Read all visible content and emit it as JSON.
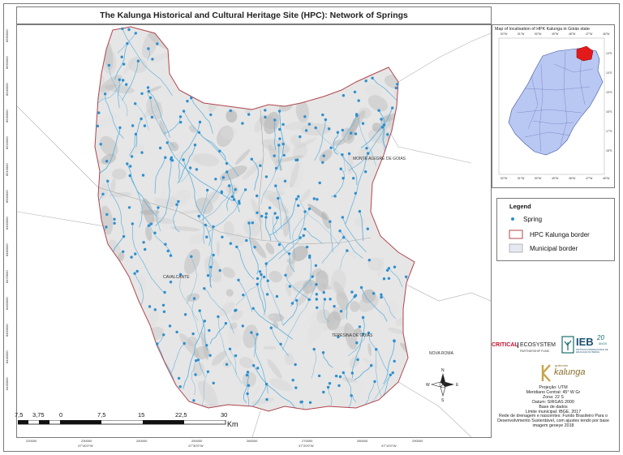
{
  "title": "The Kalunga Historical and Cultural Heritage Site (HPC): Network of Springs",
  "map": {
    "place_labels": [
      {
        "text": "MONTE ALEGRE DE GOIAS"
      },
      {
        "text": "CAVALCANTE"
      },
      {
        "text": "TERESINA DE GOIAS"
      },
      {
        "text": "NOVA ROMA"
      }
    ],
    "left_coords": [
      "8560000",
      "8550000",
      "8540000",
      "8530000",
      "8520000",
      "8510000",
      "8500000",
      "8490000",
      "8480000",
      "8470000",
      "8460000",
      "8450000",
      "8440000",
      "8430000"
    ],
    "bottom_coords": [
      "220000",
      "230000",
      "240000",
      "250000",
      "260000",
      "270000",
      "280000",
      "290000"
    ],
    "bottom_coords_deg": [
      "47°40'0\"W",
      "47°30'0\"W",
      "47°20'0\"W",
      "47°10'0\"W"
    ],
    "colors": {
      "border": "#b0444d",
      "spring": "#2d8fcf",
      "river": "#5fb0dc",
      "relief": "#d4d4d4"
    }
  },
  "inset": {
    "title": "Map of localisation of HPK Kalunga in Goiás state",
    "lon_labels": [
      "52°W",
      "51°W",
      "50°W",
      "49°W",
      "48°W",
      "47°W",
      "46°W"
    ],
    "lat_labels": [
      "13°S",
      "14°S",
      "15°S",
      "16°S",
      "17°S",
      "18°S"
    ],
    "colors": {
      "state": "#b9c8f2",
      "state_border": "#3a4fa8",
      "kalunga": "#e31a1c"
    }
  },
  "legend": {
    "title": "Legend",
    "items": [
      {
        "label": "Spring"
      },
      {
        "label": "HPC Kalunga border"
      },
      {
        "label": "Municipal border"
      }
    ]
  },
  "logos": {
    "critical": "CRITICAL",
    "ecosystem": "ECOSYSTEM",
    "partnership": "PARTNERSHIP FUND",
    "ieb": "IEB",
    "ieb_years": "20",
    "ieb_anos": "ANOS",
    "ieb_sub": "INSTITUTO INTERNACIONAL DE EDUCAÇÃO DO BRASIL",
    "kalunga_small": "quilombo",
    "kalunga": "kalunga"
  },
  "compass": {
    "n": "N",
    "s": "S",
    "e": "E",
    "w": "W"
  },
  "info": {
    "lines": [
      "Projeção: UTM",
      "Meridiano Central: 45° W Gr",
      "Zona: 22 S",
      "Datum: SIRGAS 2000",
      "Base de dados",
      "Limite municipal: IBGE, 2017",
      "Rede de drenagem e nascentes: Fundo Brasileiro Para o",
      "Desenvolvimento Sustentável, com ajustes tendo por base",
      "imagem geoeye 2018"
    ]
  },
  "scale": {
    "labels": [
      "7,5",
      "3,75",
      "0",
      "7,5",
      "15",
      "22,5",
      "30"
    ],
    "unit": "Km"
  }
}
